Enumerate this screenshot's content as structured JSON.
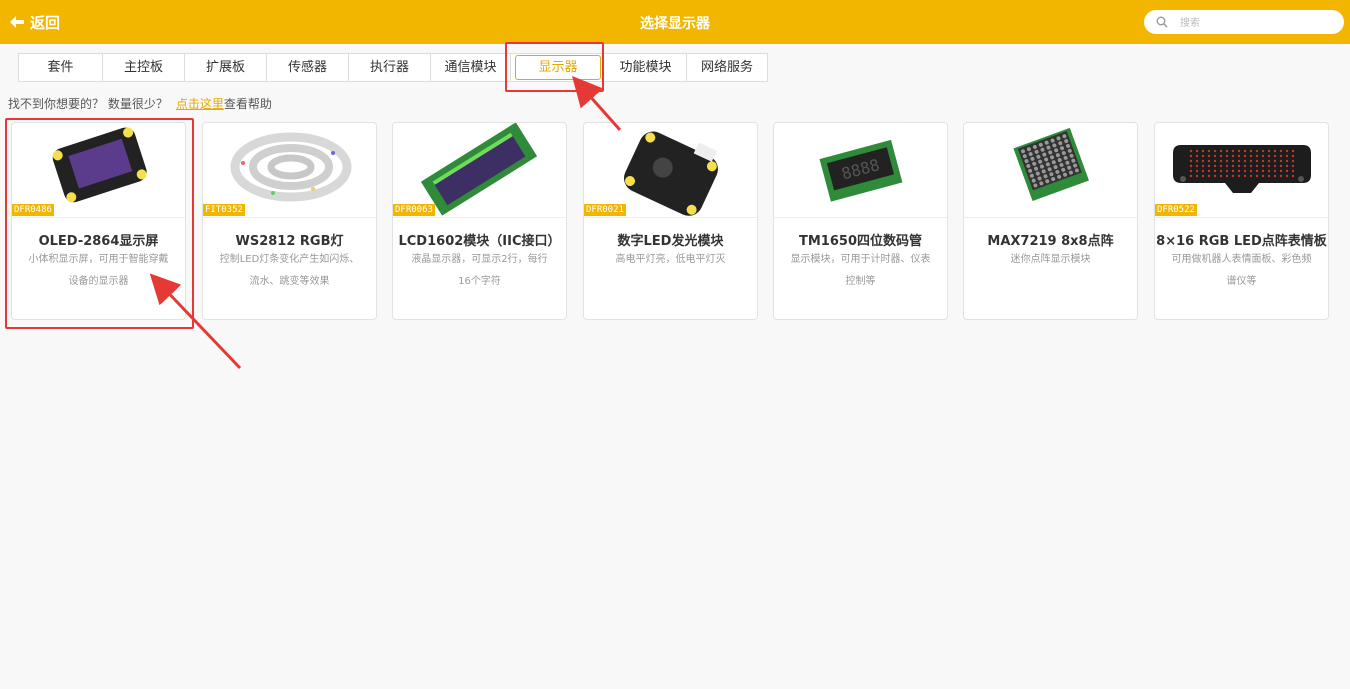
{
  "header": {
    "back_label": "返回",
    "title": "选择显示器",
    "search_placeholder": "搜索"
  },
  "tabs": [
    {
      "label": "套件"
    },
    {
      "label": "主控板"
    },
    {
      "label": "扩展板"
    },
    {
      "label": "传感器"
    },
    {
      "label": "执行器"
    },
    {
      "label": "通信模块"
    },
    {
      "label": "显示器",
      "active": true
    },
    {
      "label": "功能模块"
    },
    {
      "label": "网络服务"
    }
  ],
  "help": {
    "prefix": "找不到你想要的？ 数量很少？",
    "link": "点击这里",
    "suffix": "查看帮助"
  },
  "cards": [
    {
      "sku": "DFR0486",
      "name": "OLED-2864显示屏",
      "desc": "小体积显示屏，可用于智能穿戴设备的显示器"
    },
    {
      "sku": "FIT0352",
      "name": "WS2812 RGB灯",
      "desc": "控制LED灯条变化产生如闪烁、流水、跳变等效果"
    },
    {
      "sku": "DFR0063",
      "name": "LCD1602模块（IIC接口）",
      "desc": "液晶显示器，可显示2行，每行16个字符"
    },
    {
      "sku": "DFR0021",
      "name": "数字LED发光模块",
      "desc": "高电平灯亮，低电平灯灭"
    },
    {
      "sku": "",
      "name": "TM1650四位数码管",
      "desc": "显示模块，可用于计时器、仪表控制等"
    },
    {
      "sku": "",
      "name": "MAX7219 8x8点阵",
      "desc": "迷你点阵显示模块"
    },
    {
      "sku": "DFR0522",
      "name": "8×16 RGB LED点阵表情板",
      "desc": "可用做机器人表情面板、彩色频谱仪等"
    }
  ],
  "colors": {
    "accent": "#f2b600",
    "highlight": "#e53935"
  }
}
